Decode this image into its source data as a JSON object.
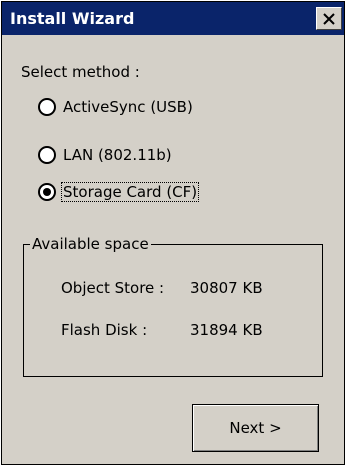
{
  "window": {
    "title": "Install Wizard",
    "close_icon": "close-icon"
  },
  "method": {
    "prompt": "Select method :",
    "options": [
      {
        "label": "ActiveSync (USB)",
        "selected": false
      },
      {
        "label": "LAN (802.11b)",
        "selected": false
      },
      {
        "label": "Storage Card (CF)",
        "selected": true
      }
    ]
  },
  "space": {
    "group_title": "Available space",
    "object_store_label": "Object Store :",
    "object_store_value": "30807 KB",
    "flash_disk_label": "Flash Disk :",
    "flash_disk_value": "31894 KB"
  },
  "buttons": {
    "next_label": "Next  >"
  },
  "colors": {
    "titlebar": "#0a246a",
    "window_bg": "#d4d0c8"
  }
}
